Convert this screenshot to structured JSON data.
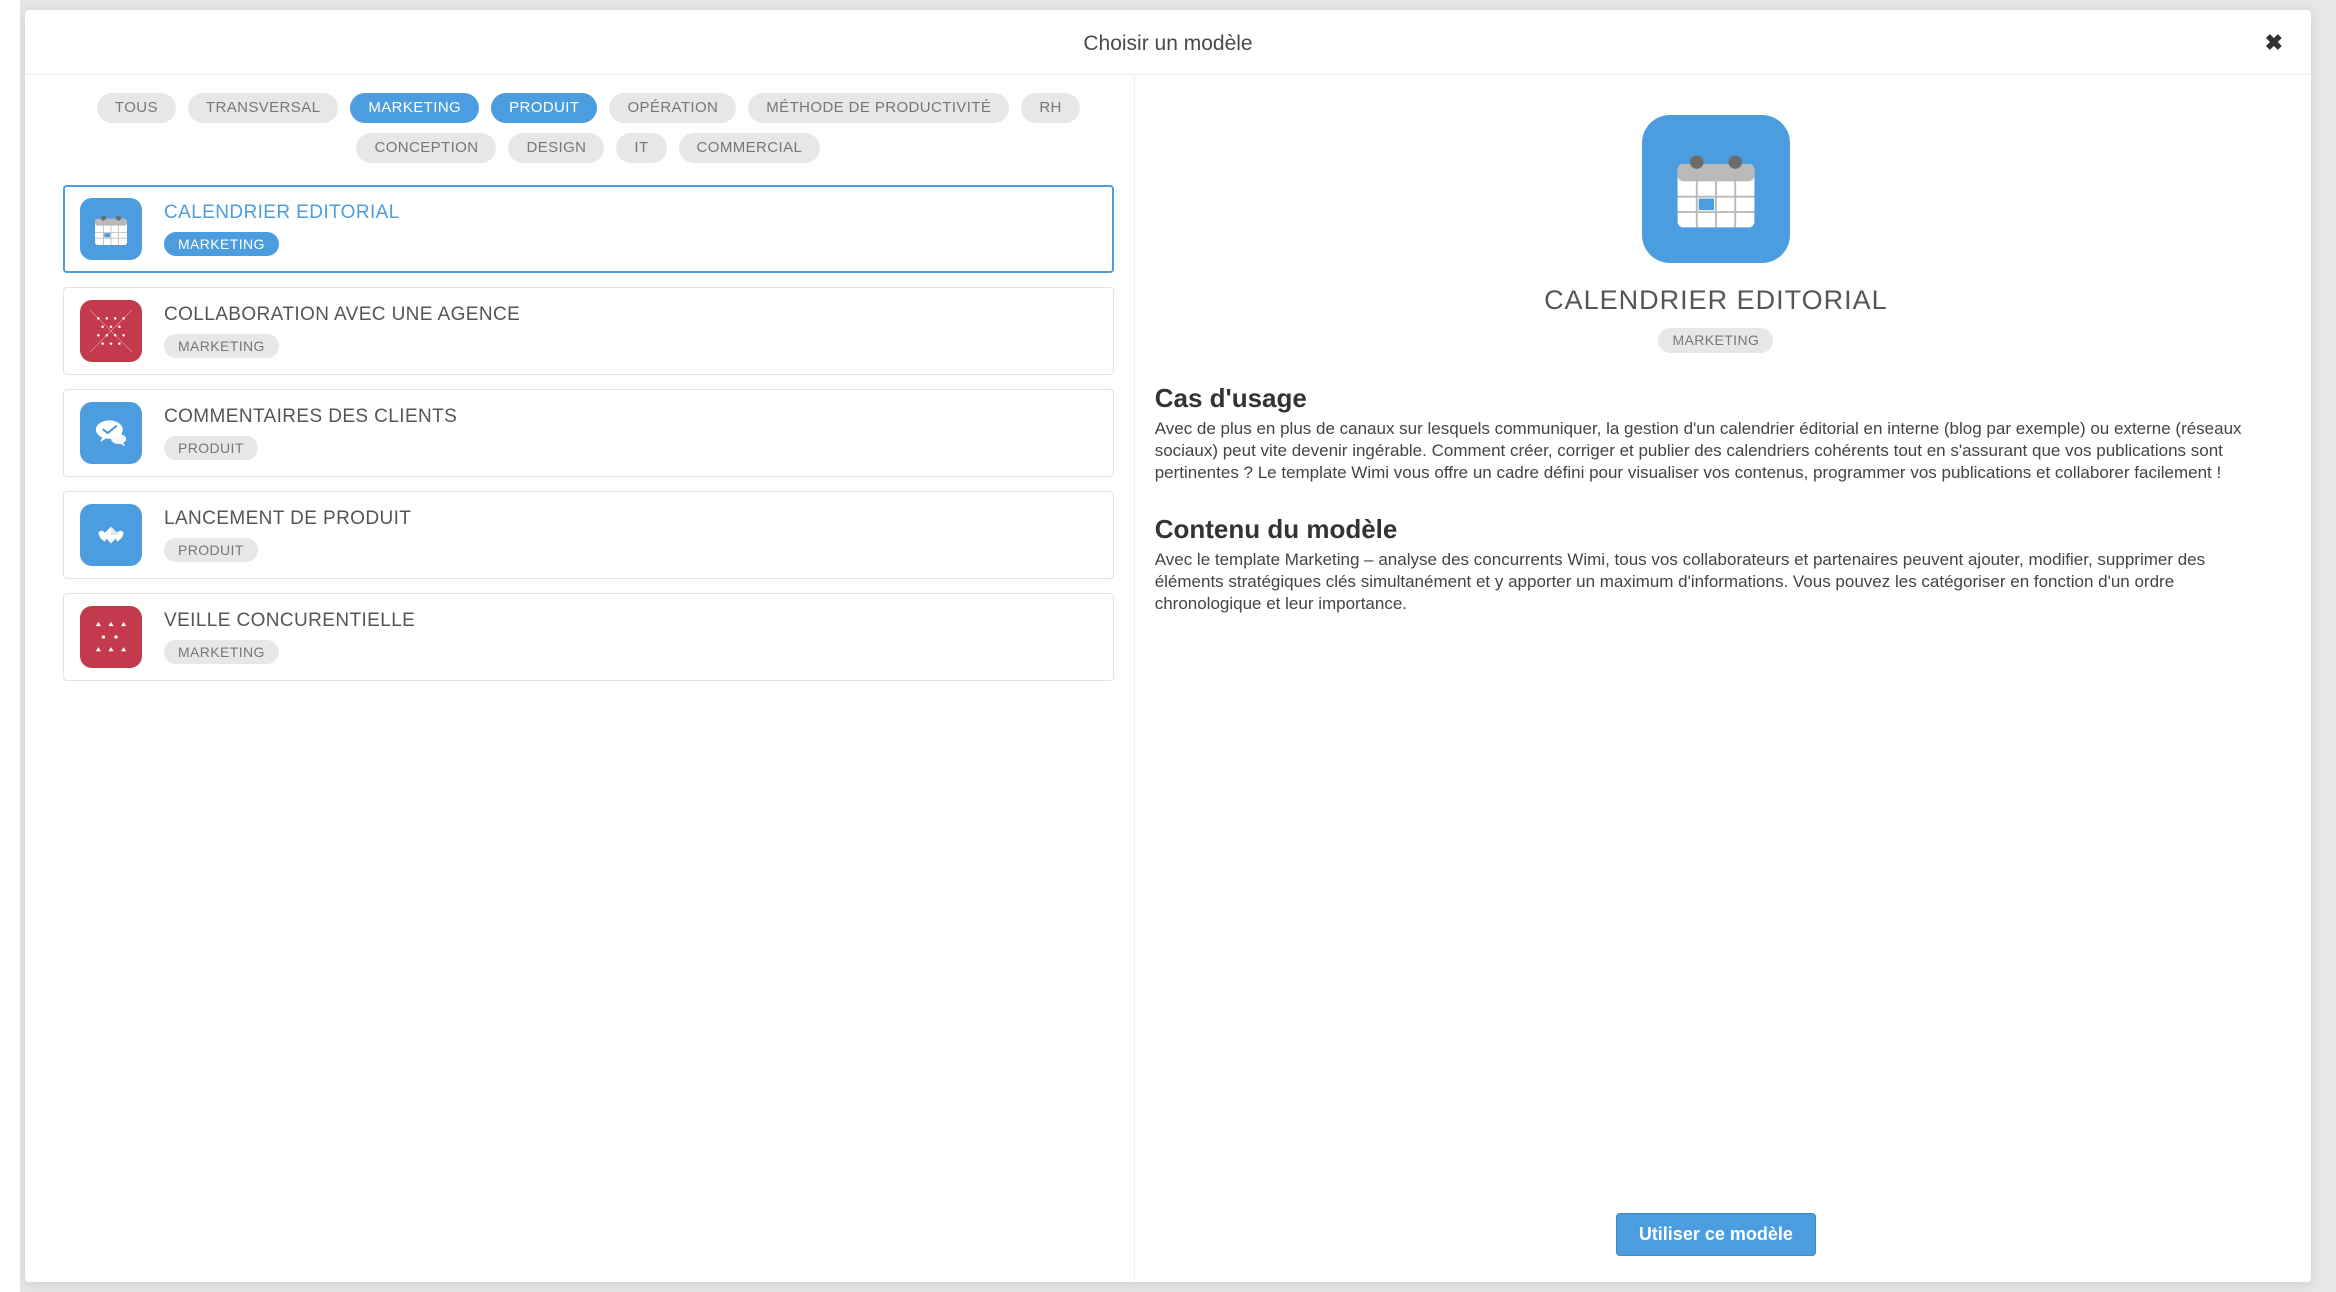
{
  "modal": {
    "title": "Choisir un modèle",
    "close_label": "Fermer"
  },
  "filters": [
    {
      "label": "TOUS",
      "active": false
    },
    {
      "label": "TRANSVERSAL",
      "active": false
    },
    {
      "label": "MARKETING",
      "active": true
    },
    {
      "label": "PRODUIT",
      "active": true
    },
    {
      "label": "OPÉRATION",
      "active": false
    },
    {
      "label": "MÉTHODE DE PRODUCTIVITÉ",
      "active": false
    },
    {
      "label": "RH",
      "active": false
    },
    {
      "label": "CONCEPTION",
      "active": false
    },
    {
      "label": "DESIGN",
      "active": false
    },
    {
      "label": "IT",
      "active": false
    },
    {
      "label": "COMMERCIAL",
      "active": false
    }
  ],
  "templates": [
    {
      "title": "CALENDRIER EDITORIAL",
      "tag": "MARKETING",
      "icon": "calendar",
      "color": "#4c9de0",
      "selected": true,
      "tag_active": true
    },
    {
      "title": "COLLABORATION AVEC UNE AGENCE",
      "tag": "MARKETING",
      "icon": "pattern",
      "color": "#c23a4b",
      "selected": false,
      "tag_active": false
    },
    {
      "title": "COMMENTAIRES DES CLIENTS",
      "tag": "PRODUIT",
      "icon": "chat",
      "color": "#4c9de0",
      "selected": false,
      "tag_active": false
    },
    {
      "title": "LANCEMENT DE PRODUIT",
      "tag": "PRODUIT",
      "icon": "launch",
      "color": "#4c9de0",
      "selected": false,
      "tag_active": false
    },
    {
      "title": "VEILLE CONCURENTIELLE",
      "tag": "MARKETING",
      "icon": "pattern2",
      "color": "#c23a4b",
      "selected": false,
      "tag_active": false
    }
  ],
  "detail": {
    "title": "CALENDRIER EDITORIAL",
    "tag": "MARKETING",
    "sections": [
      {
        "heading": "Cas d'usage",
        "body": "Avec de plus en plus de canaux sur lesquels communiquer, la gestion d'un calendrier éditorial en interne (blog par exemple) ou externe (réseaux sociaux) peut vite devenir ingérable. Comment créer, corriger et publier des calendriers cohérents tout en s'assurant que vos publications sont pertinentes ? Le template Wimi vous offre un cadre défini pour visualiser vos contenus, programmer vos publications et collaborer facilement !"
      },
      {
        "heading": "Contenu du modèle",
        "body": "Avec le template Marketing – analyse des concurrents Wimi, tous vos collaborateurs et partenaires peuvent ajouter, modifier, supprimer des éléments stratégiques clés simultanément et y apporter un maximum d'informations. Vous pouvez les catégoriser en fonction d'un ordre chronologique et leur importance."
      }
    ],
    "action": "Utiliser ce modèle"
  }
}
